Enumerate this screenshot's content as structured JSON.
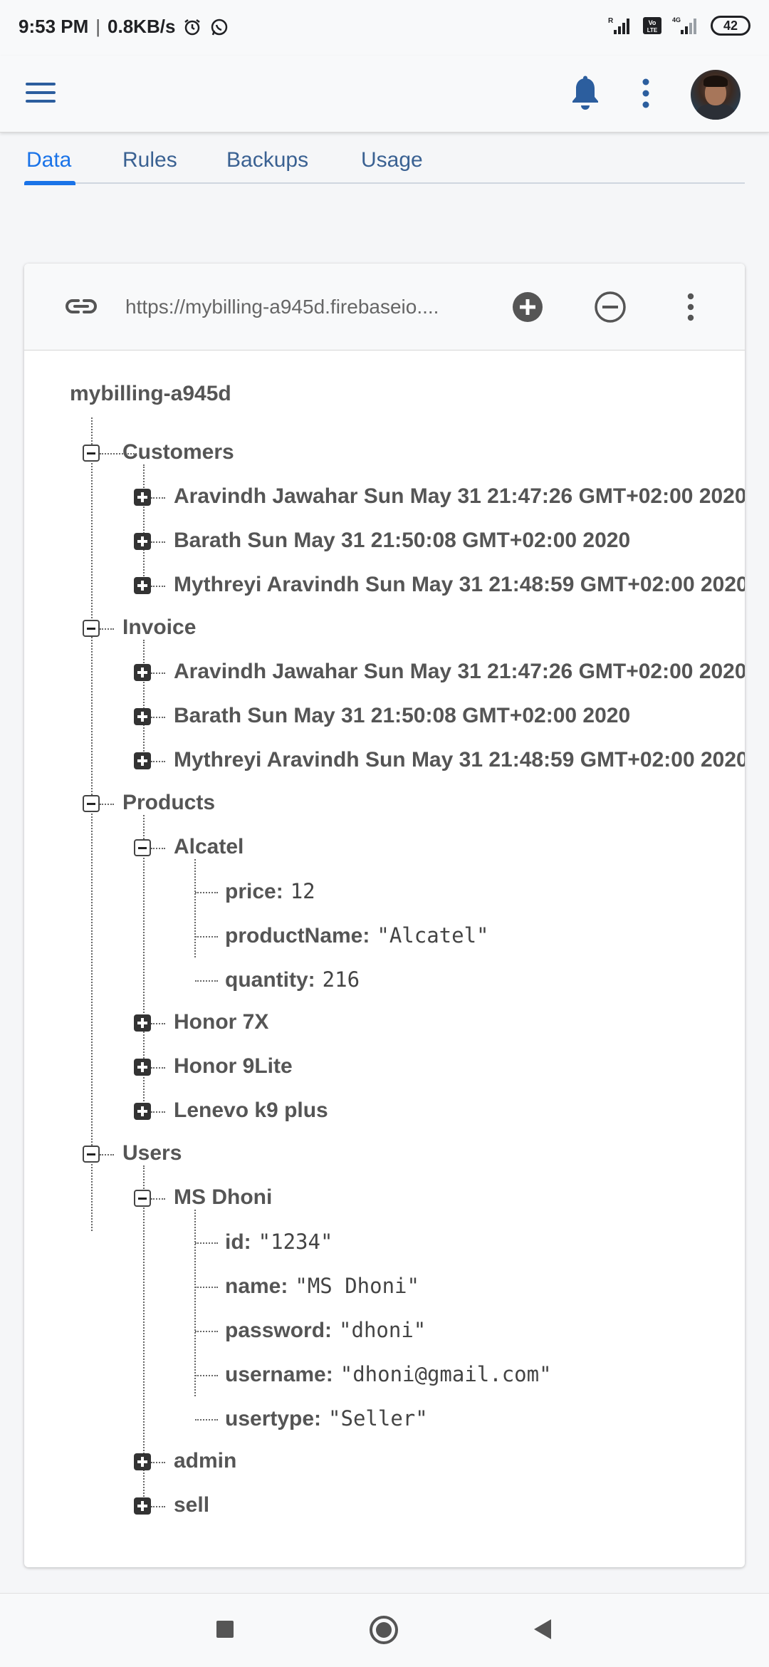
{
  "status_bar": {
    "time": "9:53 PM",
    "speed": "0.8KB/s",
    "icons": [
      "alarm-icon",
      "whatsapp-icon"
    ],
    "signal_icons": [
      "signal-icon",
      "volte-icon",
      "4g-signal-icon"
    ],
    "battery": "42"
  },
  "app_bar": {
    "icons": [
      "menu-icon",
      "bell-icon",
      "more-vert-icon",
      "avatar"
    ]
  },
  "tabs": [
    {
      "label": "Data",
      "active": true
    },
    {
      "label": "Rules",
      "active": false
    },
    {
      "label": "Backups",
      "active": false
    },
    {
      "label": "Usage",
      "active": false
    }
  ],
  "database": {
    "url": "https://mybilling-a945d.firebaseio....",
    "root": "mybilling-a945d",
    "customers": {
      "label": "Customers",
      "children": [
        "Aravindh Jawahar Sun May 31 21:47:26 GMT+02:00 2020",
        "Barath Sun May 31 21:50:08 GMT+02:00 2020",
        "Mythreyi Aravindh Sun May 31 21:48:59 GMT+02:00 2020"
      ]
    },
    "invoice": {
      "label": "Invoice",
      "children": [
        "Aravindh Jawahar Sun May 31 21:47:26 GMT+02:00 2020",
        "Barath Sun May 31 21:50:08 GMT+02:00 2020",
        "Mythreyi Aravindh Sun May 31 21:48:59 GMT+02:00 2020"
      ]
    },
    "products": {
      "label": "Products",
      "alcatel": {
        "label": "Alcatel",
        "fields": [
          {
            "key": "price:",
            "value": "12"
          },
          {
            "key": "productName:",
            "value": "\"Alcatel\""
          },
          {
            "key": "quantity:",
            "value": "216"
          }
        ]
      },
      "others": [
        "Honor 7X",
        "Honor 9Lite",
        "Lenevo k9 plus"
      ]
    },
    "users": {
      "label": "Users",
      "msdhoni": {
        "label": "MS Dhoni",
        "fields": [
          {
            "key": "id:",
            "value": "\"1234\""
          },
          {
            "key": "name:",
            "value": "\"MS Dhoni\""
          },
          {
            "key": "password:",
            "value": "\"dhoni\""
          },
          {
            "key": "username:",
            "value": "\"dhoni@gmail.com\""
          },
          {
            "key": "usertype:",
            "value": "\"Seller\""
          }
        ]
      },
      "others": [
        "admin",
        "sell"
      ]
    }
  },
  "colors": {
    "accent": "#1a73e8",
    "tab_text": "#3a6192",
    "icon_blue": "#2c5e9e"
  }
}
